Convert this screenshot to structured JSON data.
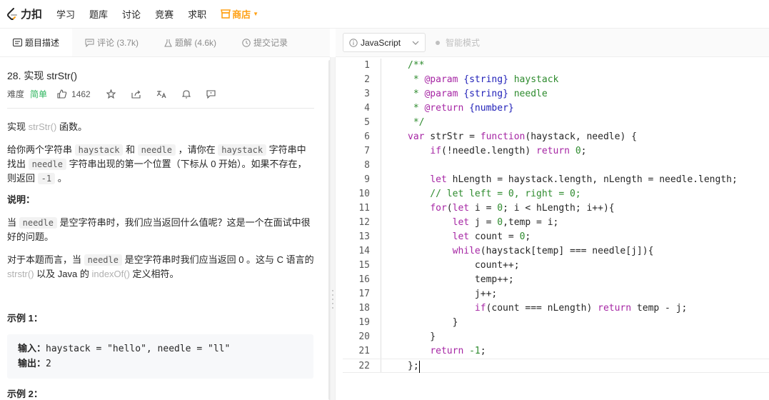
{
  "topnav": {
    "logo_text": "力扣",
    "items": [
      "学习",
      "题库",
      "讨论",
      "竞赛",
      "求职"
    ],
    "shop": "商店",
    "brand_color": "#ffa116"
  },
  "tabs": [
    {
      "label": "题目描述",
      "icon": "description-icon",
      "active": true
    },
    {
      "label": "评论 (3.7k)",
      "icon": "comment-icon",
      "active": false
    },
    {
      "label": "题解 (4.6k)",
      "icon": "flask-icon",
      "active": false
    },
    {
      "label": "提交记录",
      "icon": "clock-icon",
      "active": false
    }
  ],
  "editor_toolbar": {
    "language": "JavaScript",
    "smart_mode": "智能模式"
  },
  "problem": {
    "title": "28. 实现 strStr()",
    "difficulty_label": "难度",
    "difficulty": "简单",
    "likes": "1462",
    "p1_a": "实现 ",
    "p1_b": "strStr()",
    "p1_c": " 函数。",
    "p2_a": "给你两个字符串 ",
    "p2_code1": "haystack",
    "p2_b": " 和 ",
    "p2_code2": "needle",
    "p2_c": " ，请你在 ",
    "p2_code3": "haystack",
    "p2_d": " 字符串中找出 ",
    "p2_code4": "needle",
    "p2_e": " 字符串出现的第一个位置（下标从 0 开始）。如果不存在，则返回  ",
    "p2_code5": "-1",
    "p2_f": " 。",
    "note_heading": "说明：",
    "p3_a": "当 ",
    "p3_code": "needle",
    "p3_b": " 是空字符串时，我们应当返回什么值呢？这是一个在面试中很好的问题。",
    "p4_a": "对于本题而言，当 ",
    "p4_code": "needle",
    "p4_b": " 是空字符串时我们应当返回 0 。这与 C 语言的 ",
    "p4_c": "strstr()",
    "p4_d": " 以及 Java 的 ",
    "p4_e": "indexOf()",
    "p4_f": " 定义相符。",
    "example1_heading": "示例 1：",
    "example1_input_label": "输入：",
    "example1_input": "haystack = \"hello\", needle = \"ll\"",
    "example1_output_label": "输出：",
    "example1_output": "2",
    "example2_heading": "示例 2："
  },
  "code": {
    "line_numbers": [
      "1",
      "2",
      "3",
      "4",
      "5",
      "6",
      "7",
      "8",
      "9",
      "10",
      "11",
      "12",
      "13",
      "14",
      "15",
      "16",
      "17",
      "18",
      "19",
      "20",
      "21",
      "22"
    ],
    "lines": [
      "/**",
      " * @param {string} haystack",
      " * @param {string} needle",
      " * @return {number}",
      " */",
      "var strStr = function(haystack, needle) {",
      "    if(!needle.length) return 0;",
      "",
      "    let hLength = haystack.length, nLength = needle.length;",
      "    // let left = 0, right = 0;",
      "    for(let i = 0; i < hLength; i++){",
      "        let j = 0,temp = i;",
      "        let count = 0;",
      "        while(haystack[temp] === needle[j]){",
      "            count++;",
      "            temp++;",
      "            j++;",
      "            if(count === nLength) return temp - j;",
      "        }",
      "    }",
      "    return -1;",
      "};"
    ]
  }
}
